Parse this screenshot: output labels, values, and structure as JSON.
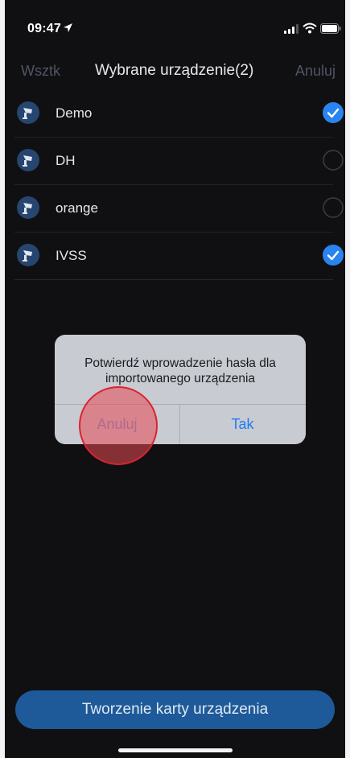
{
  "status_bar": {
    "time": "09:47",
    "icons": [
      "location-arrow-icon",
      "signal-bars-icon",
      "wifi-icon",
      "battery-icon"
    ]
  },
  "nav": {
    "left": "Wsztk",
    "title": "Wybrane urządzenie(2)",
    "right": "Anuluj"
  },
  "devices": [
    {
      "name": "Demo",
      "selected": true
    },
    {
      "name": "DH",
      "selected": false
    },
    {
      "name": "orange",
      "selected": false
    },
    {
      "name": "IVSS",
      "selected": true
    }
  ],
  "dialog": {
    "message": "Potwierdź wprowadzenie hasła dla importowanego urządzenia",
    "cancel": "Anuluj",
    "confirm": "Tak"
  },
  "bottom_button": "Tworzenie karty urządzenia",
  "colors": {
    "background": "#101013",
    "accent": "#1b7cf2",
    "check_selected": "#2a84f0",
    "bottom_button": "#1e5a99",
    "touch_indicator": "#e84a54"
  }
}
